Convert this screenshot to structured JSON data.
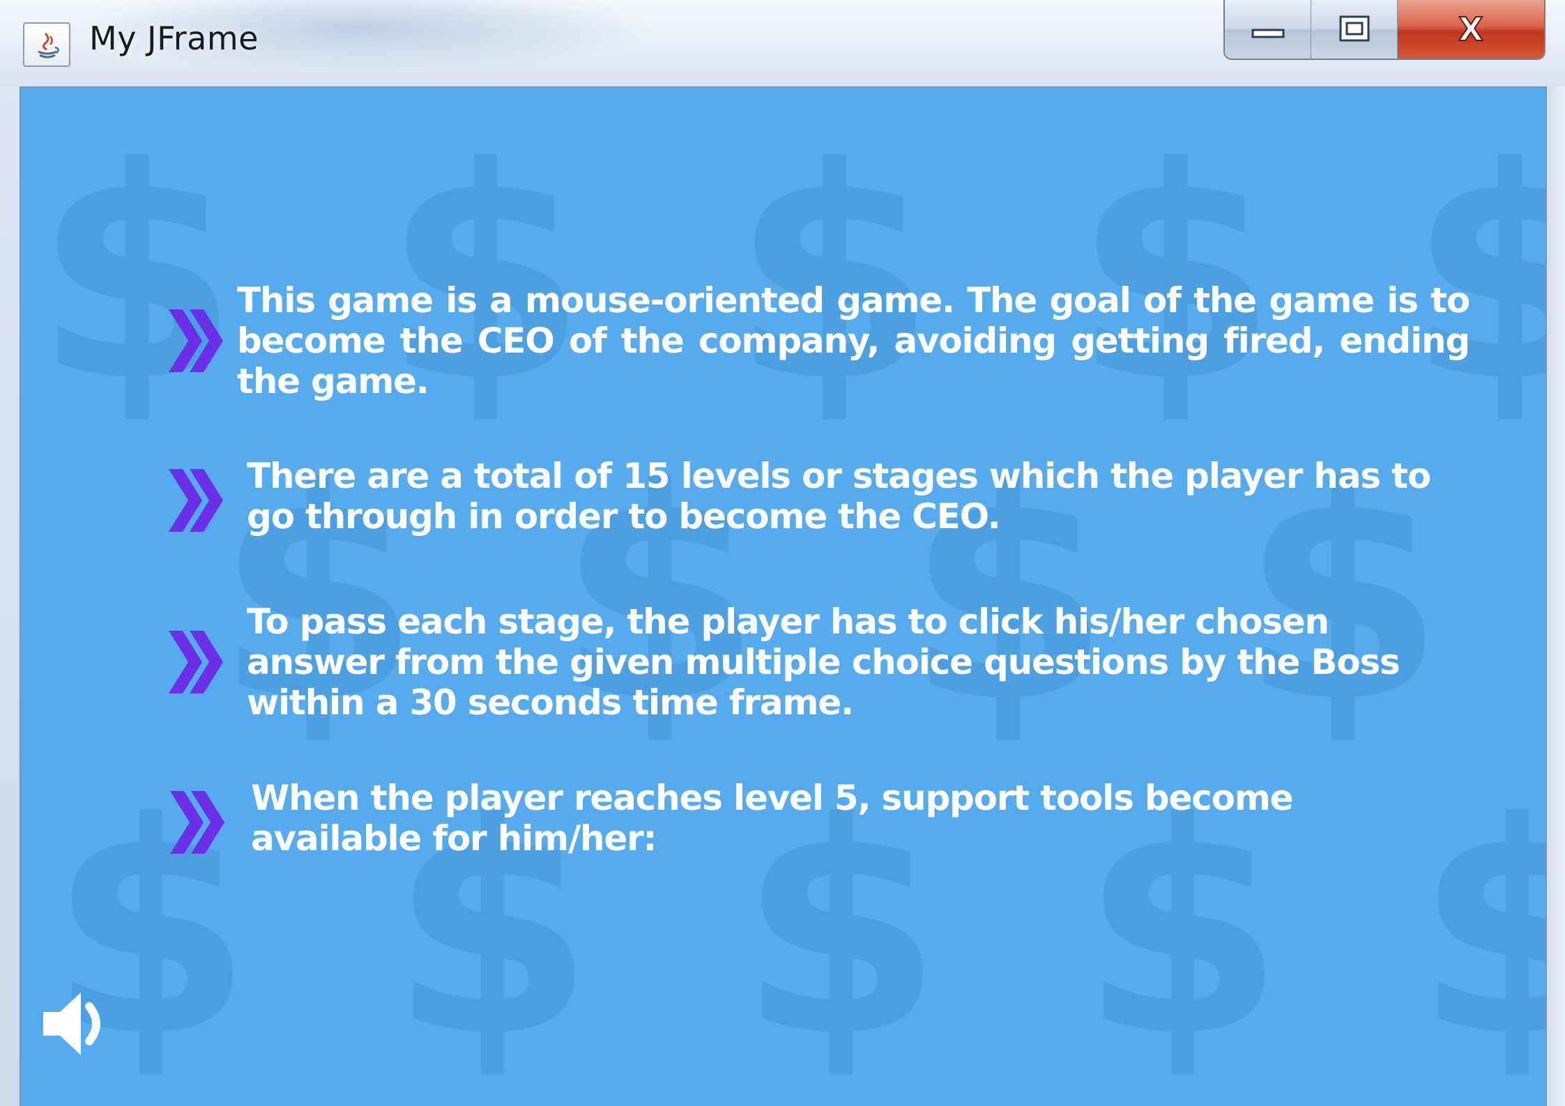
{
  "window": {
    "title": "My JFrame",
    "controls": {
      "minimize_icon": "minimize-icon",
      "maximize_icon": "maximize-icon",
      "close_icon": "close-icon",
      "close_glyph": "X"
    }
  },
  "content": {
    "background_color": "#55abee",
    "pattern_glyph": "$",
    "bullet_color": "#6a2fe6",
    "bullets": [
      {
        "text": "This game is a mouse-oriented game. The goal of the game is to become the CEO of the company, avoiding getting fired, ending the game."
      },
      {
        "text": "There are a total of 15 levels or stages which the player has to go through in order to become the CEO."
      },
      {
        "text": "To pass each stage, the player has to click his/her chosen answer from the given multiple choice questions by the Boss within a 30 seconds time frame."
      },
      {
        "text": "When the player reaches level 5, support tools become available for him/her:"
      }
    ],
    "sound_icon": "speaker-icon"
  }
}
